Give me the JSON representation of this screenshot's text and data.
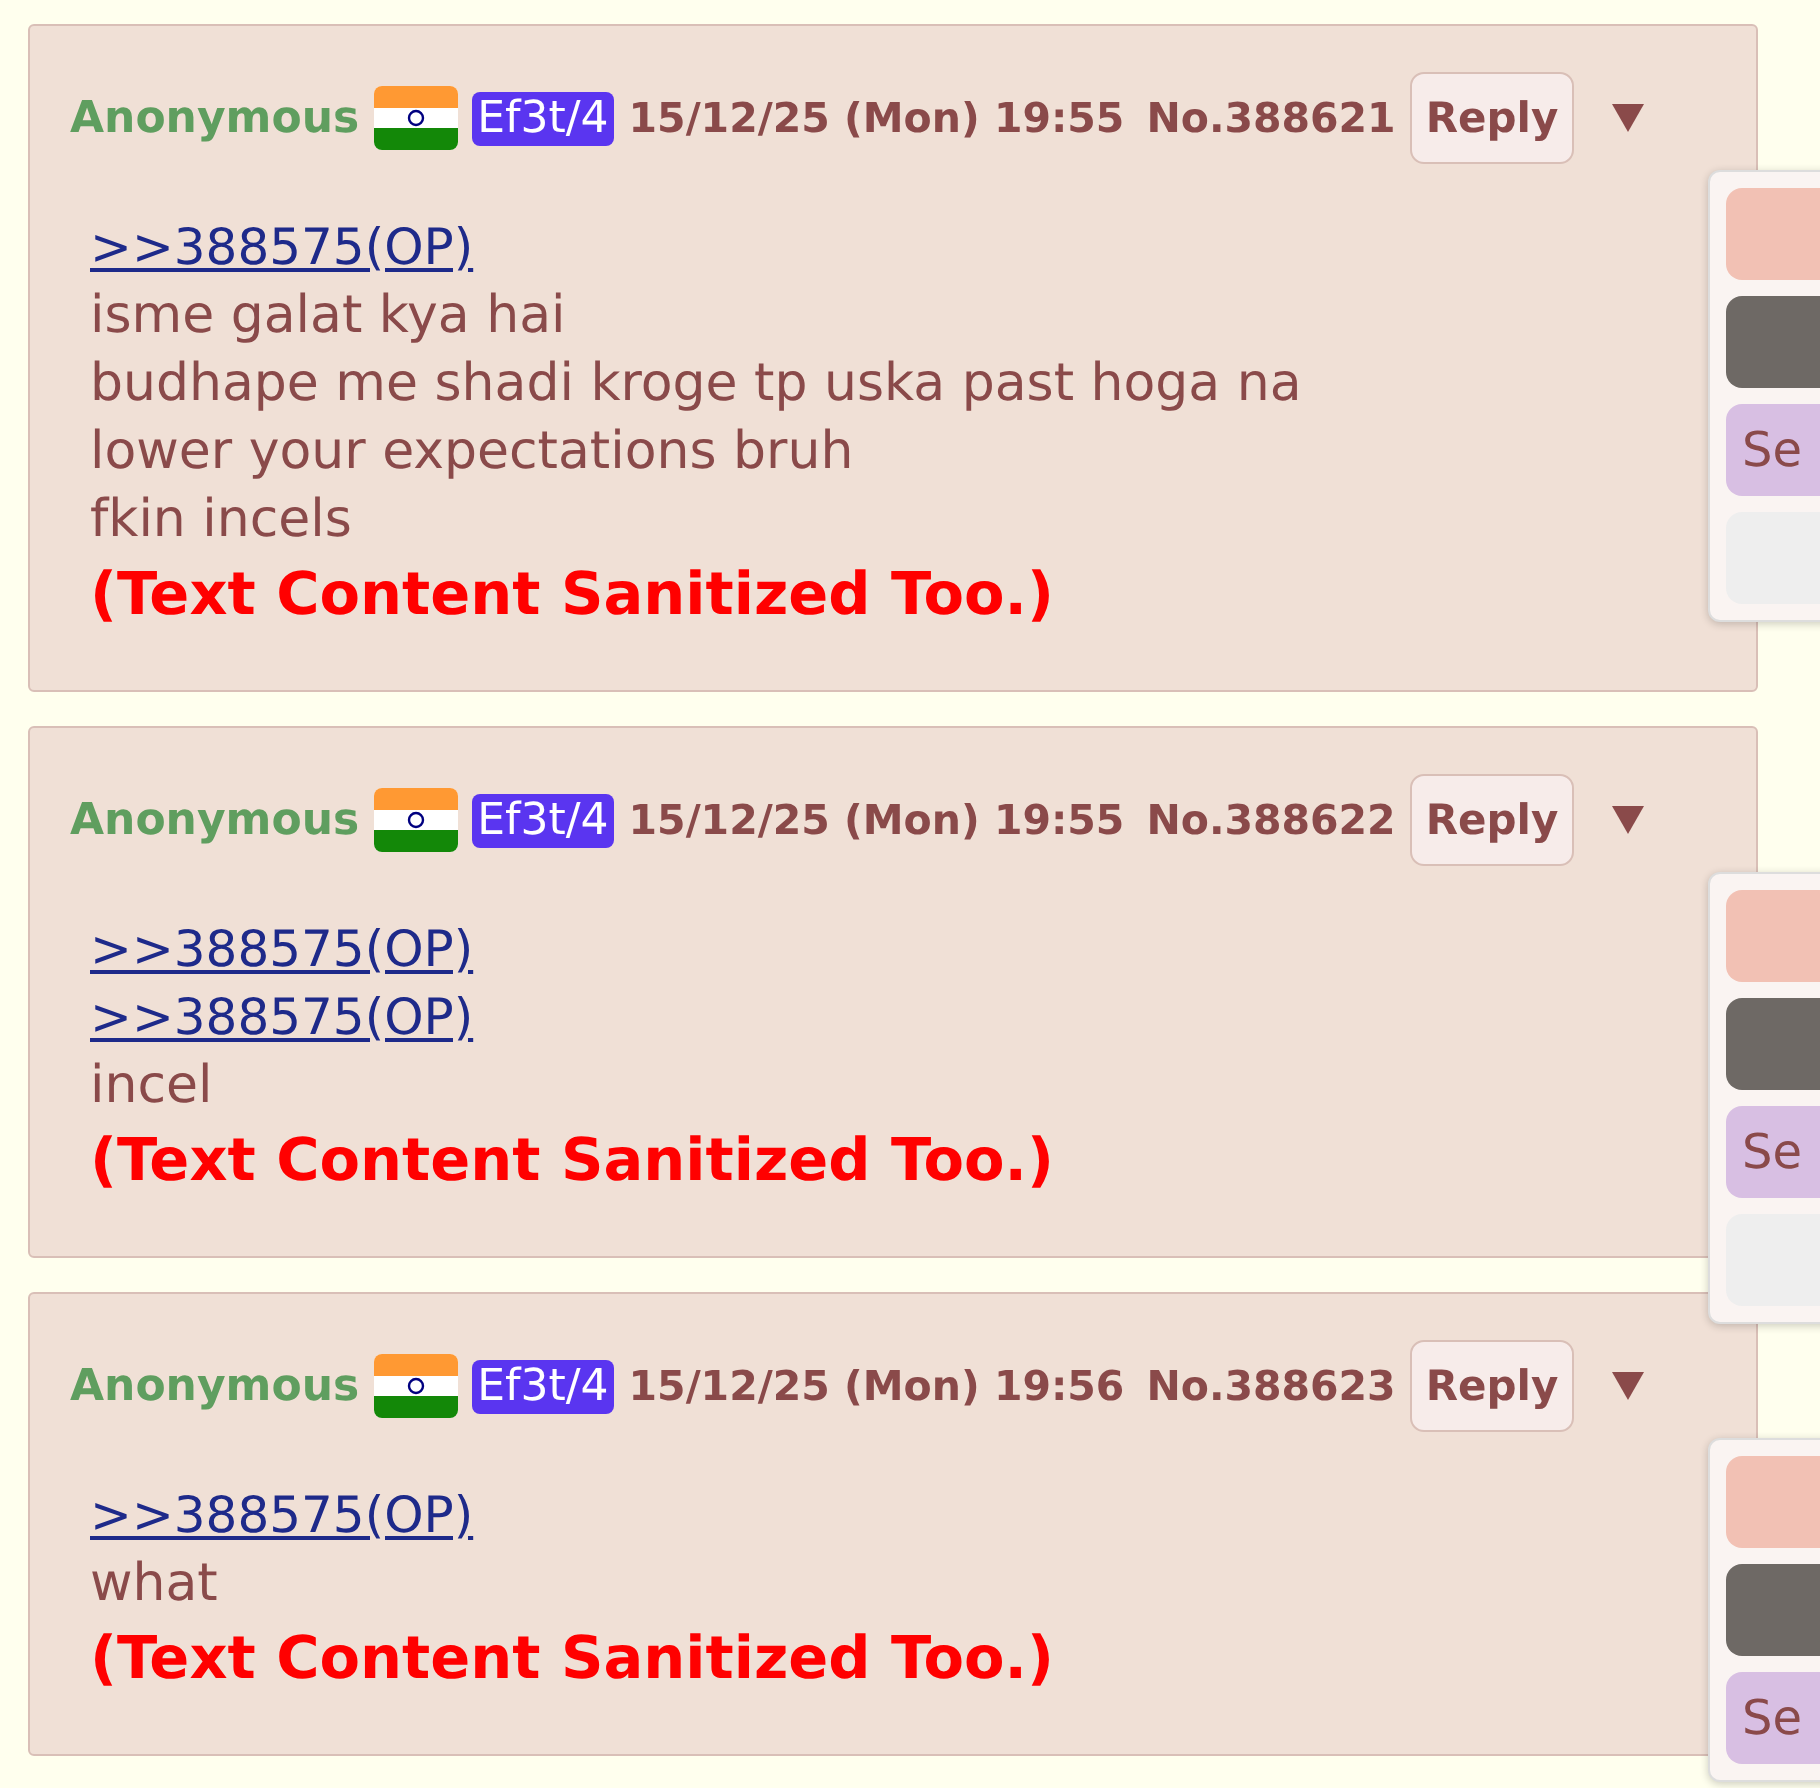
{
  "posts": [
    {
      "name": "Anonymous",
      "id_tag": "Ef3t/4",
      "date": "15/12/25 (Mon) 19:55",
      "number": "No.388621",
      "reply_button": "Reply",
      "lines": [
        {
          "kind": "quote",
          "text": ">>388575(OP)"
        },
        {
          "kind": "text",
          "text": "isme galat kya hai"
        },
        {
          "kind": "text",
          "text": "budhape me shadi kroge tp uska past hoga na"
        },
        {
          "kind": "text",
          "text": "lower your expectations bruh"
        },
        {
          "kind": "text",
          "text": "fkin incels"
        },
        {
          "kind": "notice",
          "text": "(Text Content Sanitized Too.)"
        }
      ],
      "menu": [
        {
          "color": "#f2c1b4"
        },
        {
          "color": "#6e6965"
        },
        {
          "color": "#d8bfe3",
          "label": "Se"
        },
        {
          "color": "#eeeeee"
        }
      ]
    },
    {
      "name": "Anonymous",
      "id_tag": "Ef3t/4",
      "date": "15/12/25 (Mon) 19:55",
      "number": "No.388622",
      "reply_button": "Reply",
      "lines": [
        {
          "kind": "quote",
          "text": ">>388575(OP)"
        },
        {
          "kind": "quote",
          "text": ">>388575(OP)"
        },
        {
          "kind": "text",
          "text": "incel"
        },
        {
          "kind": "notice",
          "text": "(Text Content Sanitized Too.)"
        }
      ],
      "menu": [
        {
          "color": "#f2c1b4"
        },
        {
          "color": "#6e6965"
        },
        {
          "color": "#d8bfe3",
          "label": "Se"
        },
        {
          "color": "#eeeeee"
        }
      ]
    },
    {
      "name": "Anonymous",
      "id_tag": "Ef3t/4",
      "date": "15/12/25 (Mon) 19:56",
      "number": "No.388623",
      "reply_button": "Reply",
      "lines": [
        {
          "kind": "quote",
          "text": ">>388575(OP)"
        },
        {
          "kind": "text",
          "text": "what"
        },
        {
          "kind": "notice",
          "text": "(Text Content Sanitized Too.)"
        }
      ],
      "menu": [
        {
          "color": "#f2c1b4"
        },
        {
          "color": "#6e6965"
        },
        {
          "color": "#d8bfe3",
          "label": "Se"
        }
      ]
    }
  ]
}
